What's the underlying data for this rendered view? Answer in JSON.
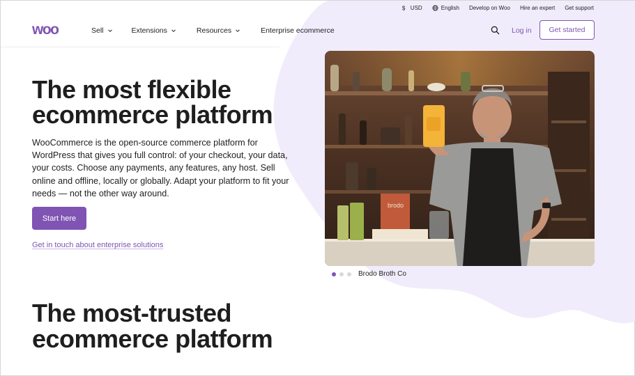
{
  "topbar": {
    "currency": "USD",
    "language": "English",
    "develop": "Develop on Woo",
    "hire": "Hire an expert",
    "support": "Get support"
  },
  "nav": {
    "logo_text": "woo",
    "items": [
      {
        "label": "Sell"
      },
      {
        "label": "Extensions"
      },
      {
        "label": "Resources"
      },
      {
        "label": "Enterprise ecommerce"
      }
    ],
    "login": "Log in",
    "get_started": "Get started"
  },
  "hero": {
    "title": "The most flexible ecommerce platform",
    "description": "WooCommerce is the open-source commerce platform for WordPress that gives you full control: of your checkout, your data, your costs. Choose any payments, any features, any host. Sell online and offline, locally or globally. Adapt your platform to fit your needs — not the other way around.",
    "start_button": "Start here",
    "enterprise_link": "Get in touch about enterprise solutions",
    "caption": "Brodo Broth Co",
    "product_label": "brodo"
  },
  "section2": {
    "title": "The most-trusted ecommerce platform"
  },
  "colors": {
    "accent": "#7f54b3",
    "blob": "#f1ecfb"
  },
  "icons": {
    "currency": "dollar-icon",
    "language": "globe-icon",
    "search": "search-icon",
    "dropdown": "chevron-down-icon"
  }
}
